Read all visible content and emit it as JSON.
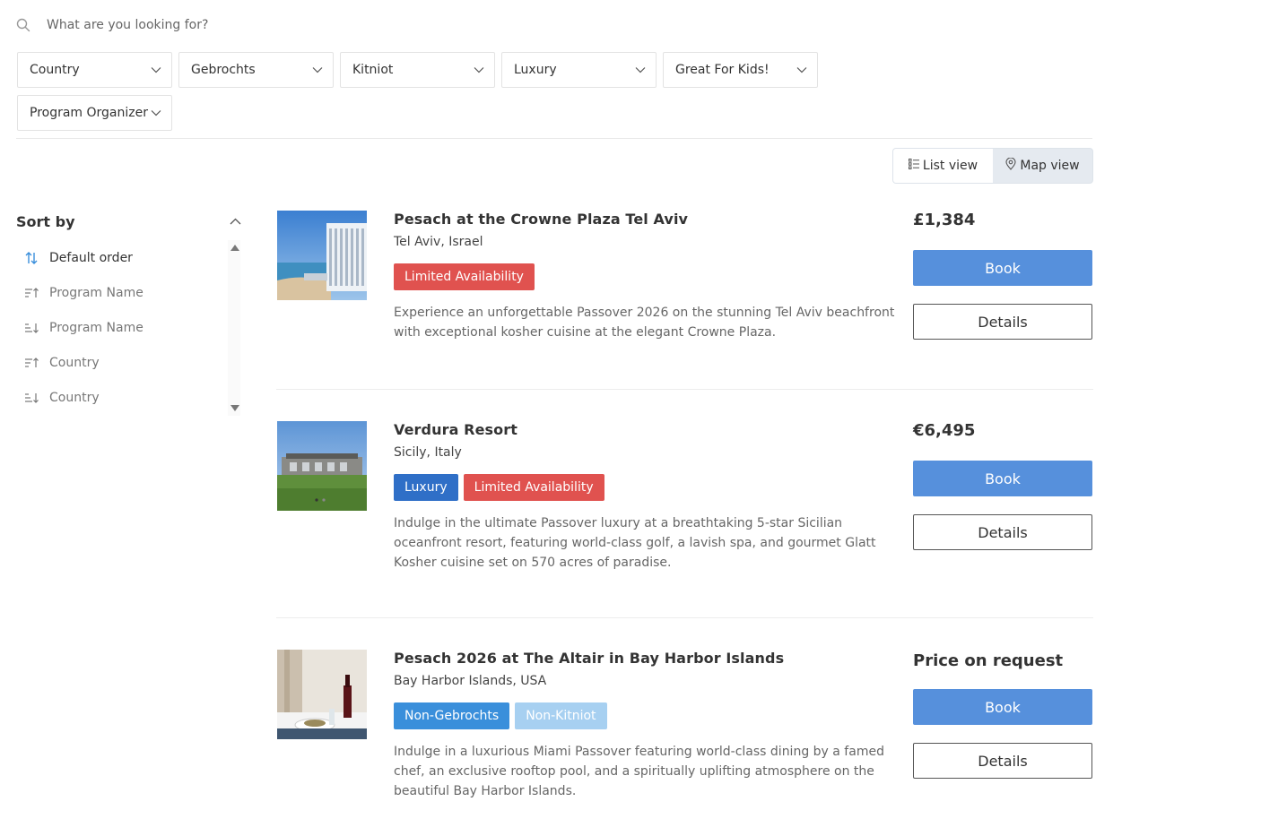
{
  "search": {
    "placeholder": "What are you looking for?"
  },
  "filters": [
    {
      "label": "Country"
    },
    {
      "label": "Gebrochts"
    },
    {
      "label": "Kitniot"
    },
    {
      "label": "Luxury"
    },
    {
      "label": "Great For Kids!"
    },
    {
      "label": "Program Organizer"
    }
  ],
  "view_toggle": {
    "list_label": "List view",
    "map_label": "Map view",
    "active": "list"
  },
  "sort": {
    "title": "Sort by",
    "items": [
      {
        "label": "Default order",
        "icon": "sort-default-icon",
        "active": true
      },
      {
        "label": "Program Name",
        "icon": "sort-asc-icon",
        "active": false
      },
      {
        "label": "Program Name",
        "icon": "sort-desc-icon",
        "active": false
      },
      {
        "label": "Country",
        "icon": "sort-asc-icon",
        "active": false
      },
      {
        "label": "Country",
        "icon": "sort-desc-icon",
        "active": false
      }
    ]
  },
  "listings": [
    {
      "title": "Pesach at the Crowne Plaza Tel Aviv",
      "location": "Tel Aviv, Israel",
      "badges": [
        {
          "label": "Limited Availability",
          "color": "#e0524f"
        }
      ],
      "description": "Experience an unforgettable Passover 2026 on the stunning Tel Aviv beachfront with exceptional kosher cuisine at the elegant Crowne Plaza.",
      "price": "£1,384",
      "book_label": "Book",
      "details_label": "Details"
    },
    {
      "title": "Verdura Resort",
      "location": "Sicily, Italy",
      "badges": [
        {
          "label": "Luxury",
          "color": "#2f6fc7"
        },
        {
          "label": "Limited Availability",
          "color": "#e0524f"
        }
      ],
      "description": "Indulge in the ultimate Passover luxury at a breathtaking 5-star Sicilian oceanfront resort, featuring world-class golf, a lavish spa, and gourmet Glatt Kosher cuisine set on 570 acres of paradise.",
      "price": "€6,495",
      "book_label": "Book",
      "details_label": "Details"
    },
    {
      "title": "Pesach 2026 at The Altair in Bay Harbor Islands",
      "location": "Bay Harbor Islands, USA",
      "badges": [
        {
          "label": "Non-Gebrochts",
          "color": "#3a8fdb"
        },
        {
          "label": "Non-Kitniot",
          "color": "#a7d0f1"
        }
      ],
      "description": "Indulge in a luxurious Miami Passover featuring world-class dining by a famed chef, an exclusive rooftop pool, and a spiritually uplifting atmosphere on the beautiful Bay Harbor Islands.",
      "price": "Price on request",
      "book_label": "Book",
      "details_label": "Details"
    }
  ]
}
